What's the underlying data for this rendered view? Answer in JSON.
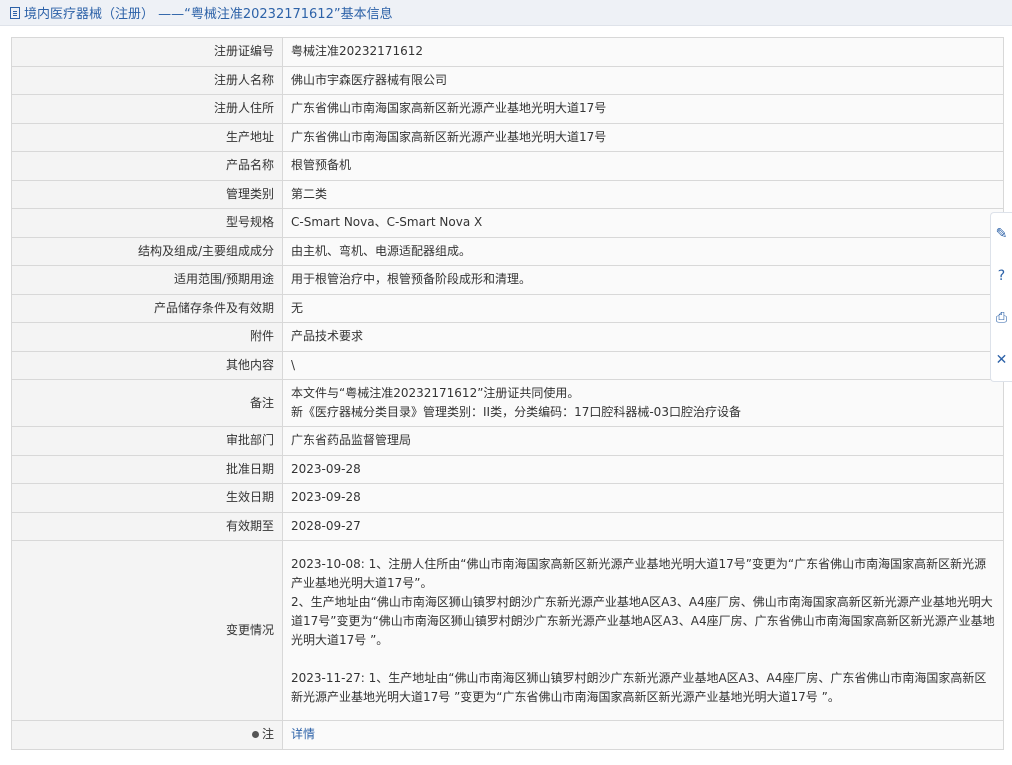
{
  "header": {
    "title": "境内医疗器械（注册） ——“粤械注准20232171612”基本信息"
  },
  "rows": [
    {
      "label": "注册证编号",
      "value": "粤械注准20232171612"
    },
    {
      "label": "注册人名称",
      "value": "佛山市宇森医疗器械有限公司"
    },
    {
      "label": "注册人住所",
      "value": "广东省佛山市南海国家高新区新光源产业基地光明大道17号"
    },
    {
      "label": "生产地址",
      "value": "广东省佛山市南海国家高新区新光源产业基地光明大道17号"
    },
    {
      "label": "产品名称",
      "value": "根管预备机"
    },
    {
      "label": "管理类别",
      "value": "第二类"
    },
    {
      "label": "型号规格",
      "value": "C-Smart Nova、C-Smart Nova X"
    },
    {
      "label": "结构及组成/主要组成成分",
      "value": "由主机、弯机、电源适配器组成。"
    },
    {
      "label": "适用范围/预期用途",
      "value": "用于根管治疗中，根管预备阶段成形和清理。"
    },
    {
      "label": "产品储存条件及有效期",
      "value": "无"
    },
    {
      "label": "附件",
      "value": "产品技术要求"
    },
    {
      "label": "其他内容",
      "value": "\\"
    }
  ],
  "remark": {
    "label": "备注",
    "line1": "本文件与“粤械注准20232171612”注册证共同使用。",
    "line2": "新《医疗器械分类目录》管理类别：II类，分类编码：17口腔科器械-03口腔治疗设备"
  },
  "rows2": [
    {
      "label": "审批部门",
      "value": "广东省药品监督管理局"
    },
    {
      "label": "批准日期",
      "value": "2023-09-28"
    },
    {
      "label": "生效日期",
      "value": "2023-09-28"
    },
    {
      "label": "有效期至",
      "value": "2028-09-27"
    }
  ],
  "changes": {
    "label": "变更情况",
    "p1": "2023-10-08: 1、注册人住所由“佛山市南海国家高新区新光源产业基地光明大道17号”变更为“广东省佛山市南海国家高新区新光源产业基地光明大道17号”。",
    "p2": "2、生产地址由“佛山市南海区狮山镇罗村朗沙广东新光源产业基地A区A3、A4座厂房、佛山市南海国家高新区新光源产业基地光明大道17号”变更为“佛山市南海区狮山镇罗村朗沙广东新光源产业基地A区A3、A4座厂房、广东省佛山市南海国家高新区新光源产业基地光明大道17号 ”。",
    "p3": "2023-11-27: 1、生产地址由“佛山市南海区狮山镇罗村朗沙广东新光源产业基地A区A3、A4座厂房、广东省佛山市南海国家高新区新光源产业基地光明大道17号 ”变更为“广东省佛山市南海国家高新区新光源产业基地光明大道17号 ”。"
  },
  "footer_row": {
    "label": "注",
    "link": "详情"
  },
  "sidebar": {
    "icons": [
      "edit-icon",
      "help-icon",
      "print-icon",
      "close-icon"
    ],
    "glyphs": [
      "✎",
      "?",
      "⎙",
      "✕"
    ]
  },
  "colors": {
    "accent": "#2d62a8",
    "label_bg": "#f4f4f4",
    "value_bg": "#fafafa",
    "border": "#d8d8d8"
  }
}
